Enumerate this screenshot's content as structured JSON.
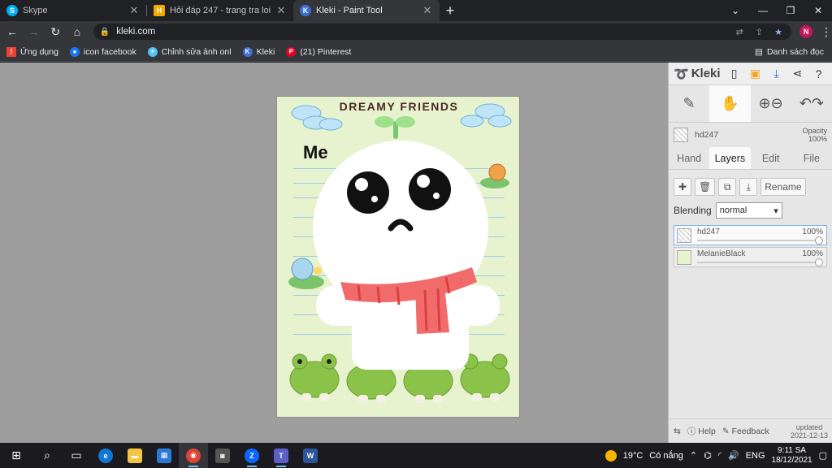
{
  "browser": {
    "tabs": [
      {
        "title": "Skype",
        "favicon": "skype-icon",
        "color": "#00aff0",
        "glyph": "S",
        "active": false
      },
      {
        "title": "Hỏi đáp 247 - trang tra loi",
        "favicon": "hoidap-icon",
        "color": "#f2a900",
        "glyph": "H",
        "active": false
      },
      {
        "title": "Kleki - Paint Tool",
        "favicon": "kleki-icon",
        "color": "#3b6fd4",
        "glyph": "K",
        "active": true
      }
    ],
    "new_tab": "+",
    "url": "kleki.com",
    "profile_initial": "N",
    "bookmarks": [
      {
        "label": "Ứng dụng",
        "icon": "apps-grid-icon",
        "color": "#ea4335"
      },
      {
        "label": "icon facebook",
        "icon": "facebook-icon",
        "color": "#1877f2"
      },
      {
        "label": "Chỉnh sửa ảnh onl",
        "icon": "photo-edit-icon",
        "color": "#4fc3f7"
      },
      {
        "label": "Kleki",
        "icon": "kleki-icon",
        "color": "#3b6fd4"
      },
      {
        "label": "(21) Pinterest",
        "icon": "pinterest-icon",
        "color": "#e60023"
      }
    ],
    "reading_list": "Danh sách đọc"
  },
  "canvas": {
    "title": "DREAMY FRIENDS",
    "me_label": "Me"
  },
  "kleki": {
    "logo": "Kleki",
    "layer_name": "hd247",
    "opacity_label": "Opacity",
    "opacity_value": "100%",
    "tabs": [
      "Hand",
      "Layers",
      "Edit",
      "File"
    ],
    "active_tab": "Layers",
    "rename_label": "Rename",
    "blending_label": "Blending",
    "blending_value": "normal",
    "layers": [
      {
        "name": "hd247",
        "opacity": "100%",
        "active": true
      },
      {
        "name": "MelanieBlack",
        "opacity": "100%",
        "active": false
      }
    ],
    "help_label": "Help",
    "feedback_label": "Feedback",
    "updated_label": "updated",
    "updated_date": "2021-12-13"
  },
  "taskbar": {
    "weather_temp": "19°C",
    "weather_text": "Có nắng",
    "lang": "ENG",
    "time": "9:11 SA",
    "date": "18/12/2021"
  },
  "colors": {
    "chrome_dark": "#202124",
    "chrome_toolbar": "#35363a",
    "accent_blue": "#8ab4f8",
    "kleki_download": "#1976d2",
    "canvas_bg": "#e7f2cf",
    "scarf_red": "#f26b6b",
    "frog_green": "#8bc34a"
  }
}
